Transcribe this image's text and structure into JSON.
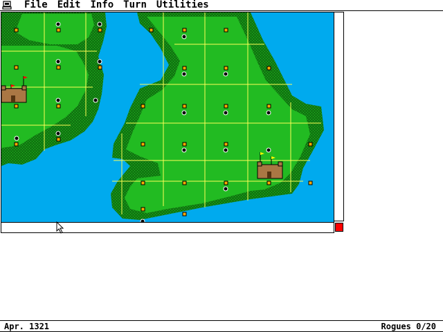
{
  "menubar": {
    "items": [
      "File",
      "Edit",
      "Info",
      "Turn",
      "Utilities"
    ]
  },
  "icons": {
    "apple": "computer-icon",
    "cursor": "arrow-cursor-icon"
  },
  "colors": {
    "water": "#00aaee",
    "land_light": "#22bb22",
    "land_dark": "#117711",
    "grid": "#ffff55",
    "town": "#ffaa00",
    "scroll_corner": "#ff0000"
  },
  "map": {
    "castles": [
      {
        "name": "castle-west",
        "flag_color": "#ff0000"
      },
      {
        "name": "castle-east",
        "flag_color": "#ffff00"
      }
    ]
  },
  "status": {
    "date": "Apr. 1321",
    "rogues": "Rogues 0/20"
  }
}
